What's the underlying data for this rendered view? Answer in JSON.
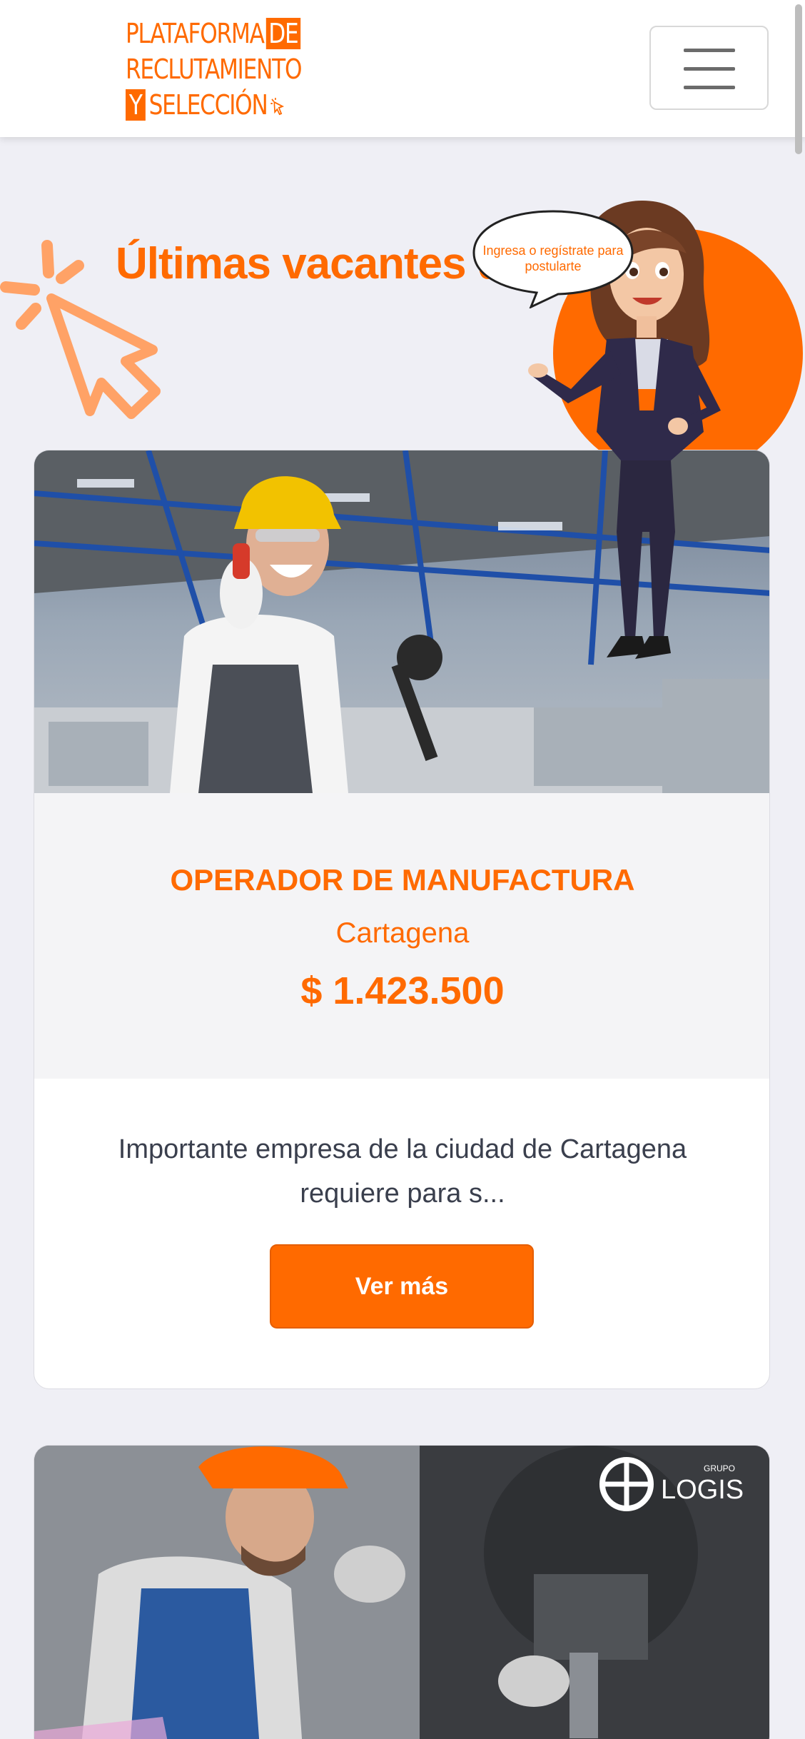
{
  "brand": {
    "logo_line1": "PLATAFORMA",
    "logo_line1_box": "DE",
    "logo_line2": "RECLUTAMIENTO",
    "logo_line3_box": "Y",
    "logo_line3": "SELECCIÓN",
    "accent_color": "#ff6a00"
  },
  "nav": {
    "menu_icon": "hamburger-menu-icon"
  },
  "hero": {
    "title": "Últimas vacantes d",
    "speech_bubble": "Ingresa o regístrate para postularte"
  },
  "jobs": [
    {
      "title": "OPERADOR DE MANUFACTURA",
      "city": "Cartagena",
      "salary": "$ 1.423.500",
      "description": "Importante empresa de la ciudad de Cartagena requiere para s...",
      "button_label": "Ver más"
    },
    {
      "image_brand_small": "GRUPO",
      "image_brand": "LOGIS"
    }
  ]
}
